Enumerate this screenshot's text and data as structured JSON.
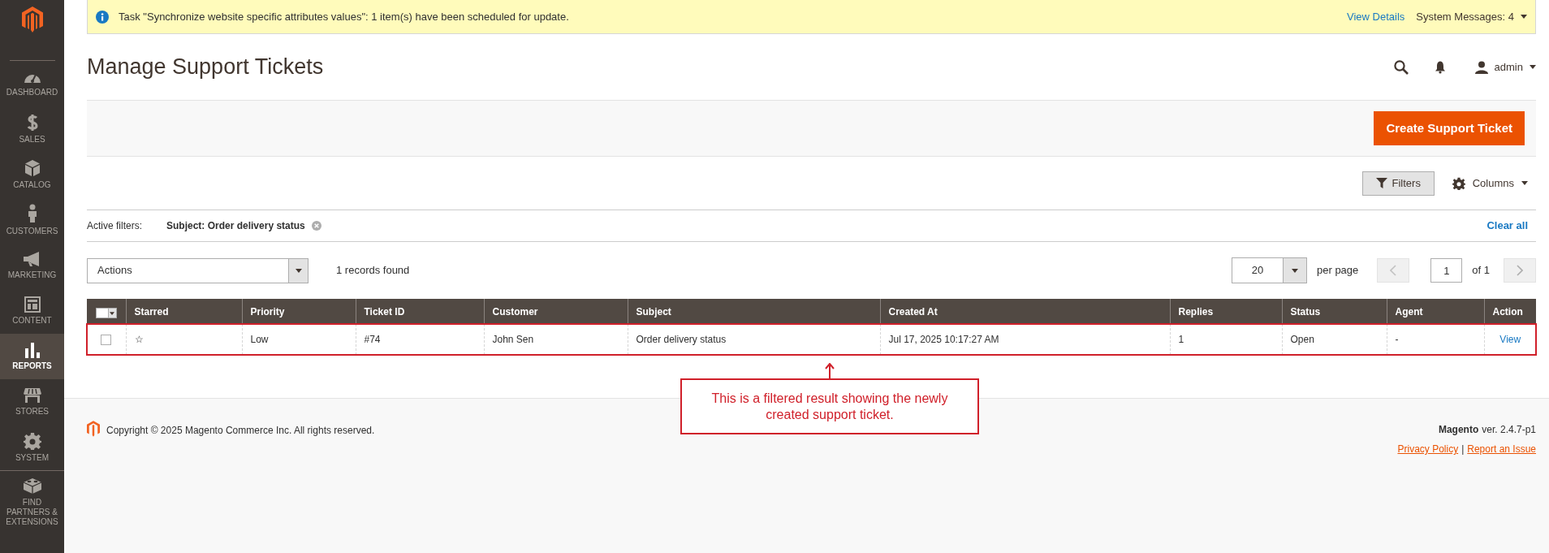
{
  "sidebar": {
    "items": [
      {
        "kind": "dashboard",
        "label": "DASHBOARD",
        "selected": false
      },
      {
        "kind": "sales",
        "label": "SALES",
        "selected": false
      },
      {
        "kind": "catalog",
        "label": "CATALOG",
        "selected": false
      },
      {
        "kind": "customers",
        "label": "CUSTOMERS",
        "selected": false
      },
      {
        "kind": "marketing",
        "label": "MARKETING",
        "selected": false
      },
      {
        "kind": "content",
        "label": "CONTENT",
        "selected": false
      },
      {
        "kind": "reports",
        "label": "REPORTS",
        "selected": true
      },
      {
        "kind": "stores",
        "label": "STORES",
        "selected": false
      },
      {
        "kind": "system",
        "label": "SYSTEM",
        "selected": false
      },
      {
        "kind": "partners",
        "label": "FIND PARTNERS & EXTENSIONS",
        "selected": false
      }
    ]
  },
  "message": {
    "text": "Task \"Synchronize website specific attributes values\": 1 item(s) have been scheduled for update.",
    "link": "View Details",
    "system_messages": "System Messages: 4"
  },
  "header": {
    "title": "Manage Support Tickets",
    "user": "admin"
  },
  "create_button": "Create Support Ticket",
  "toolbar": {
    "filters": "Filters",
    "columns": "Columns"
  },
  "active_filters": {
    "label": "Active filters:",
    "chips": [
      "Subject: Order delivery status"
    ],
    "clear": "Clear all"
  },
  "actions": "Actions",
  "records": "1 records found",
  "per_page": {
    "value": "20",
    "label": "per page"
  },
  "pager": {
    "value": "1",
    "total": "of 1"
  },
  "table": {
    "mass_select": {
      "checked": false
    },
    "columns": [
      "Starred",
      "Priority",
      "Ticket ID",
      "Customer",
      "Subject",
      "Created At",
      "Replies",
      "Status",
      "Agent",
      "Action"
    ],
    "rows": [
      {
        "checked": false,
        "highlighted": true,
        "cells": [
          "☆",
          "Low",
          "#74",
          "John Sen",
          "Order delivery status",
          "Jul 17, 2025 10:17:27 AM",
          "1",
          "Open",
          "-",
          "View"
        ]
      }
    ]
  },
  "annotation": {
    "text": "This is a filtered result showing the newly created support ticket."
  },
  "footer": {
    "copyright": "Copyright © 2025 Magento Commerce Inc. All rights reserved.",
    "brand": "Magento",
    "version": "ver. 2.4.7-p1",
    "links": [
      "Privacy Policy",
      "Report an Issue"
    ],
    "separator": "|"
  }
}
